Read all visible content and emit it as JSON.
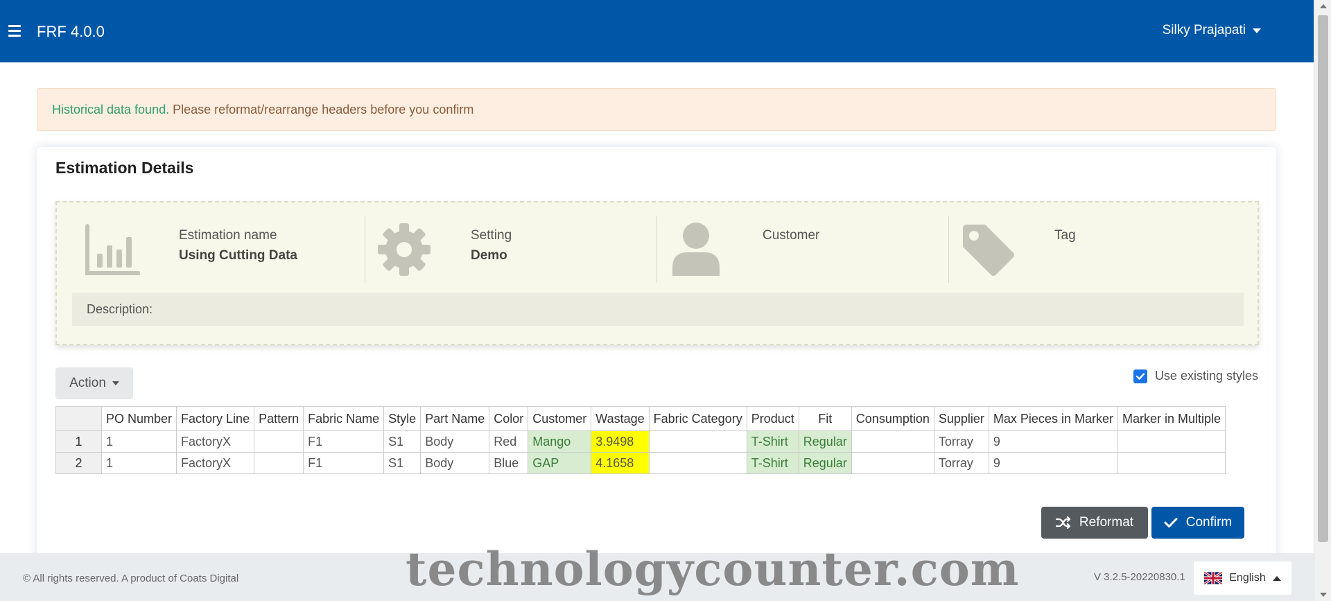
{
  "header": {
    "app_title": "FRF 4.0.0",
    "user_name": "Silky Prajapati"
  },
  "alert": {
    "highlight": "Historical data found.",
    "message": "Please reformat/rearrange headers before you confirm"
  },
  "card": {
    "title": "Estimation Details",
    "info": [
      {
        "label": "Estimation name",
        "value": "Using Cutting Data",
        "icon": "bar-chart-icon"
      },
      {
        "label": "Setting",
        "value": "Demo",
        "icon": "gear-icon"
      },
      {
        "label": "Customer",
        "value": "",
        "icon": "user-icon"
      },
      {
        "label": "Tag",
        "value": "",
        "icon": "tag-icon"
      }
    ],
    "description_label": "Description:"
  },
  "toolbar": {
    "action_label": "Action",
    "use_existing_styles_label": "Use existing styles",
    "use_existing_styles_checked": true
  },
  "table": {
    "headers": [
      "",
      "PO Number",
      "Factory Line",
      "Pattern",
      "Fabric Name",
      "Style",
      "Part Name",
      "Color",
      "Customer",
      "Wastage",
      "Fabric Category",
      "Product",
      "Fit",
      "Consumption",
      "Supplier",
      "Max Pieces in Marker",
      "Marker in Multiple"
    ],
    "rows": [
      [
        "1",
        "1",
        "FactoryX",
        "",
        "F1",
        "S1",
        "Body",
        "Red",
        "Mango",
        "3.9498",
        "",
        "T-Shirt",
        "Regular",
        "",
        "Torray",
        "9",
        ""
      ],
      [
        "2",
        "1",
        "FactoryX",
        "",
        "F1",
        "S1",
        "Body",
        "Blue",
        "GAP",
        "4.1658",
        "",
        "T-Shirt",
        "Regular",
        "",
        "Torray",
        "9",
        ""
      ]
    ],
    "green_columns": [
      8,
      11,
      12
    ],
    "yellow_columns": [
      9
    ]
  },
  "buttons": {
    "reformat_label": "Reformat",
    "confirm_label": "Confirm"
  },
  "footer": {
    "copyright": "© All rights reserved. A product of Coats Digital",
    "version": "V 3.2.5-20220830.1",
    "language": "English",
    "watermark": "technologycounter.com"
  },
  "colors": {
    "primary": "#0057a8",
    "alert_bg": "#fdeee1",
    "highlight_green": "#d7ecd0",
    "highlight_yellow": "#ffff00"
  }
}
